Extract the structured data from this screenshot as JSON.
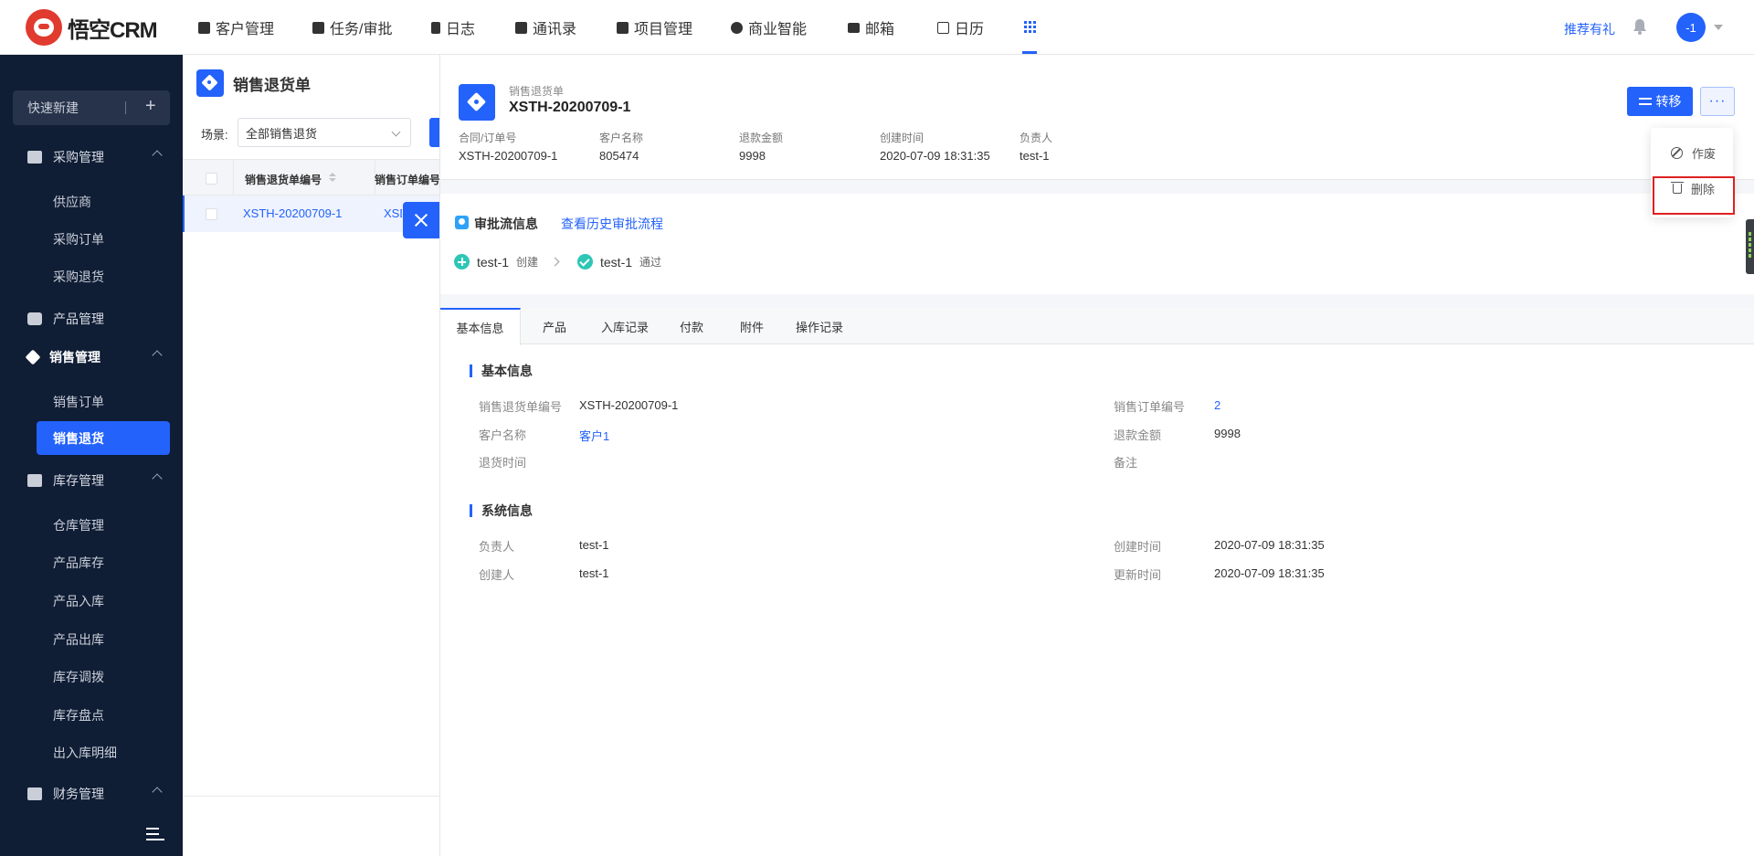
{
  "brand": {
    "name": "悟空CRM"
  },
  "nav": {
    "items": [
      "客户管理",
      "任务/审批",
      "日志",
      "通讯录",
      "项目管理",
      "商业智能",
      "邮箱",
      "日历"
    ],
    "apps_icon": "grid-icon",
    "promo": "推荐有礼",
    "avatar_text": "-1"
  },
  "sidebar": {
    "quick_new": "快速新建",
    "groups": {
      "purchase": {
        "label": "采购管理",
        "items": [
          "供应商",
          "采购订单",
          "采购退货"
        ]
      },
      "product": {
        "label": "产品管理"
      },
      "sales": {
        "label": "销售管理",
        "items": [
          "销售订单",
          "销售退货"
        ],
        "active": "销售退货"
      },
      "inventory": {
        "label": "库存管理",
        "items": [
          "仓库管理",
          "产品库存",
          "产品入库",
          "产品出库",
          "库存调拨",
          "库存盘点",
          "出入库明细"
        ]
      },
      "finance": {
        "label": "财务管理"
      }
    }
  },
  "list": {
    "title": "销售退货单",
    "scene_label": "场景:",
    "scene_value": "全部销售退货",
    "columns": [
      "销售退货单编号",
      "销售订单编号"
    ],
    "rows": [
      {
        "no": "XSTH-20200709-1",
        "order": "XSD"
      }
    ]
  },
  "detail": {
    "type": "销售退货单",
    "number": "XSTH-20200709-1",
    "meta": [
      {
        "label": "合同/订单号",
        "value": "XSTH-20200709-1"
      },
      {
        "label": "客户名称",
        "value": "805474"
      },
      {
        "label": "退款金额",
        "value": "9998"
      },
      {
        "label": "创建时间",
        "value": "2020-07-09 18:31:35"
      },
      {
        "label": "负责人",
        "value": "test-1"
      }
    ],
    "buttons": {
      "transfer": "转移",
      "more": "···"
    },
    "dropdown": [
      "作废",
      "删除"
    ],
    "approval": {
      "title": "审批流信息",
      "history_link": "查看历史审批流程",
      "steps": [
        {
          "user": "test-1",
          "action": "创建"
        },
        {
          "user": "test-1",
          "action": "通过"
        }
      ]
    },
    "tabs": [
      "基本信息",
      "产品",
      "入库记录",
      "付款",
      "附件",
      "操作记录"
    ],
    "basic": {
      "title": "基本信息",
      "fields": [
        {
          "label": "销售退货单编号",
          "value": "XSTH-20200709-1"
        },
        {
          "label": "销售订单编号",
          "value": "2"
        },
        {
          "label": "客户名称",
          "value": "客户1"
        },
        {
          "label": "退款金额",
          "value": "9998"
        },
        {
          "label": "退货时间",
          "value": ""
        },
        {
          "label": "备注",
          "value": ""
        }
      ]
    },
    "system": {
      "title": "系统信息",
      "fields": [
        {
          "label": "负责人",
          "value": "test-1"
        },
        {
          "label": "创建时间",
          "value": "2020-07-09 18:31:35"
        },
        {
          "label": "创建人",
          "value": "test-1"
        },
        {
          "label": "更新时间",
          "value": "2020-07-09 18:31:35"
        }
      ]
    }
  },
  "colors": {
    "accent": "#2362fb",
    "sidebar_bg": "#0f1d35",
    "highlight": "#e02020",
    "success": "#2ec6b6"
  }
}
